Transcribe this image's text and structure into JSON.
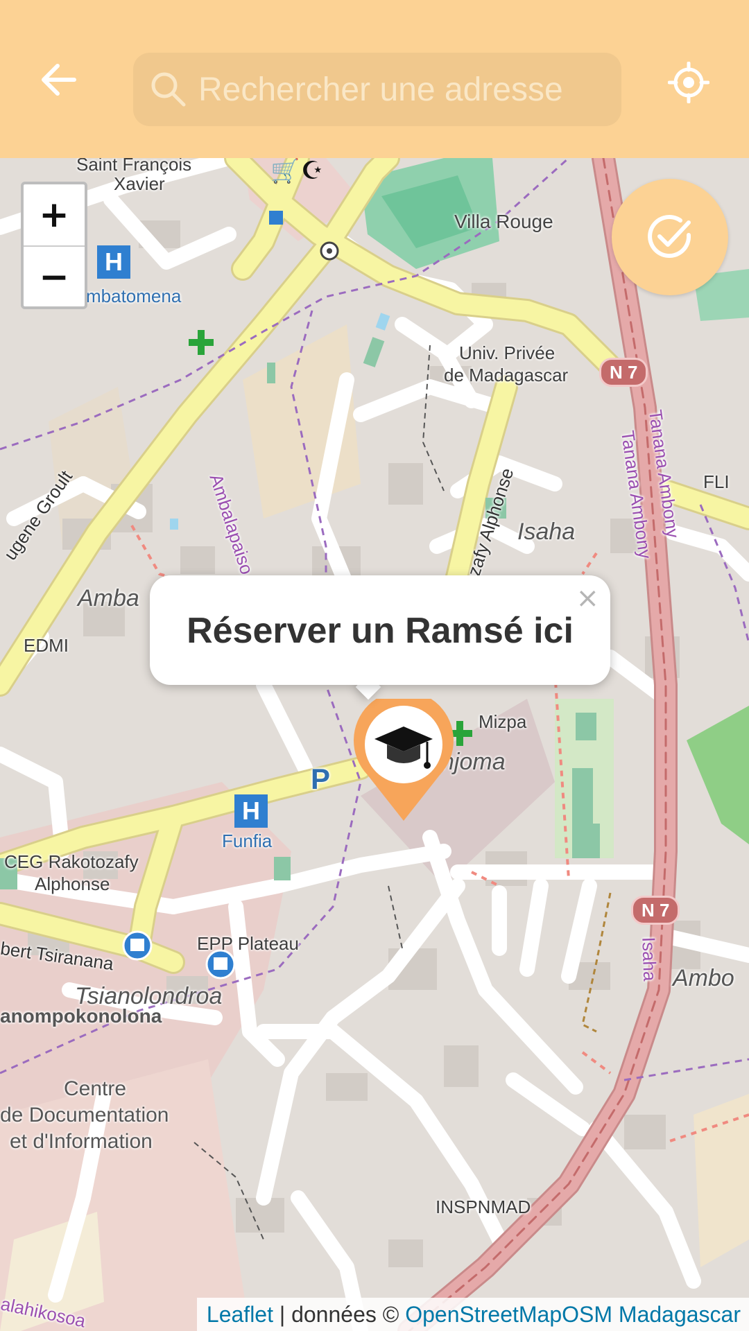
{
  "header": {
    "search_placeholder": "Rechercher une adresse",
    "back_icon": "arrow-left-icon",
    "locate_icon": "crosshair-icon",
    "background_color": "#fcd294"
  },
  "zoom": {
    "in_label": "+",
    "out_label": "−"
  },
  "fab": {
    "icon": "check-circle-icon",
    "color": "#fcd294"
  },
  "popup": {
    "text": "Réserver un Ramsé ici",
    "close_label": "×"
  },
  "marker": {
    "icon": "graduation-cap-icon",
    "color": "#f7a55a"
  },
  "map_labels": {
    "saint_francois_1": "Saint François",
    "saint_francois_2": "Xavier",
    "villa_rouge": "Villa Rouge",
    "ambatomena": "mbatomena",
    "univ_1": "Univ. Privée",
    "univ_2": "de Madagascar",
    "eugene_groult": "ugene Groult",
    "ambalapaiso": "Ambalapaiso",
    "rakotozafy_alphonse": "akotozafy Alphonse",
    "isaha": "Isaha",
    "tanana_ambony_1": "Tanana Ambony",
    "tanana_ambony_2": "Tanana Ambony",
    "fli": "FLI",
    "amba": "Amba",
    "edmi": "EDMI",
    "mizpa": "Mizpa",
    "njoma": "njoma",
    "funfia": "Funfia",
    "ceg_1": "CEG Rakotozafy",
    "ceg_2": "Alphonse",
    "epp_plateau": "EPP Plateau",
    "bert_tsiranana": "bert Tsiranana",
    "tsianolondroa": "Tsianolondroa",
    "anompokonolona": "anompokonolona",
    "centre_1": "Centre",
    "centre_2": "de Documentation",
    "centre_3": "et d'Information",
    "inspnmad": "INSPNMAD",
    "ambo": "Ambo",
    "isaha_v": "Isaha",
    "alahikosoa": "alahikosoa",
    "n7_a": "N 7",
    "n7_b": "N 7",
    "hospital_1": "H",
    "hospital_2": "H",
    "parking": "P"
  },
  "attribution": {
    "leaflet": "Leaflet",
    "separator": " | données © ",
    "osm": "OpenStreetMapOSM Madagascar"
  }
}
